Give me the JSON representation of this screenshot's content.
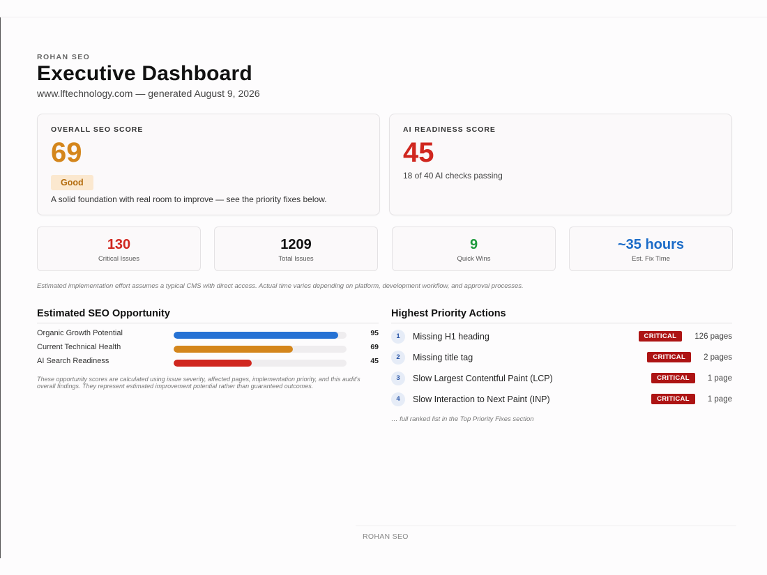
{
  "brand": "ROHAN SEO",
  "title": "Executive Dashboard",
  "subtitle": "www.lftechnology.com — generated August 9, 2026",
  "seo_card": {
    "label": "OVERALL SEO SCORE",
    "score": "69",
    "badge": "Good",
    "description": "A solid foundation with real room to improve — see the priority fixes below."
  },
  "ai_card": {
    "label": "AI READINESS SCORE",
    "score": "45",
    "description": "18 of 40 AI checks passing"
  },
  "stats": [
    {
      "value": "130",
      "label": "Critical Issues"
    },
    {
      "value": "1209",
      "label": "Total Issues"
    },
    {
      "value": "9",
      "label": "Quick Wins"
    },
    {
      "value": "~35 hours",
      "label": "Est. Fix Time"
    }
  ],
  "effort_note": "Estimated implementation effort assumes a typical CMS with direct access. Actual time varies depending on platform, development workflow, and approval processes.",
  "opportunity": {
    "title": "Estimated SEO Opportunity",
    "rows": [
      {
        "label": "Organic Growth Potential",
        "value": "95",
        "percent": 95,
        "color": "#2672d4"
      },
      {
        "label": "Current Technical Health",
        "value": "69",
        "percent": 69,
        "color": "#d4861c"
      },
      {
        "label": "AI Search Readiness",
        "value": "45",
        "percent": 45,
        "color": "#d0271f"
      }
    ],
    "note": "These opportunity scores are calculated using issue severity, affected pages, implementation priority, and this audit's overall findings. They represent estimated improvement potential rather than guaranteed outcomes."
  },
  "actions": {
    "title": "Highest Priority Actions",
    "items": [
      {
        "num": "1",
        "title": "Missing H1 heading",
        "severity": "CRITICAL",
        "pages": "126 pages"
      },
      {
        "num": "2",
        "title": "Missing title tag",
        "severity": "CRITICAL",
        "pages": "2 pages"
      },
      {
        "num": "3",
        "title": "Slow Largest Contentful Paint (LCP)",
        "severity": "CRITICAL",
        "pages": "1 page"
      },
      {
        "num": "4",
        "title": "Slow Interaction to Next Paint (INP)",
        "severity": "CRITICAL",
        "pages": "1 page"
      }
    ],
    "note": "… full ranked list in the Top Priority Fixes section"
  },
  "footer": "ROHAN SEO"
}
